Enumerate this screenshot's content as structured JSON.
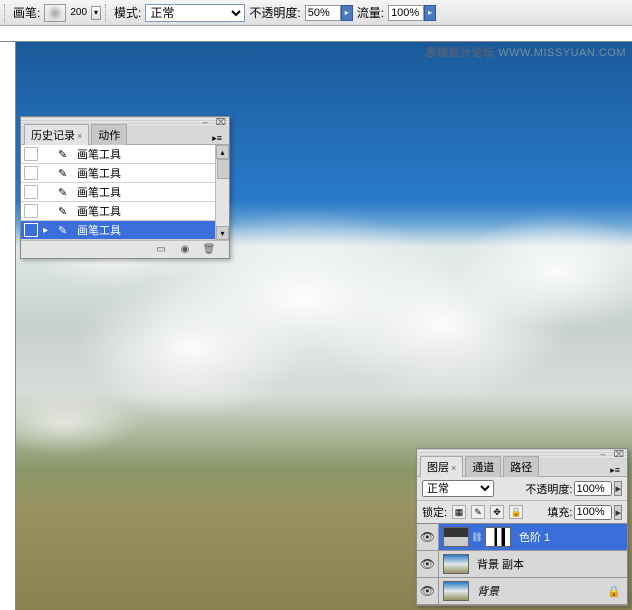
{
  "toolbar": {
    "brush_label": "画笔:",
    "brush_size": "200",
    "mode_label": "模式:",
    "mode_value": "正常",
    "opacity_label": "不透明度:",
    "opacity_value": "50%",
    "flow_label": "流量:",
    "flow_value": "100%"
  },
  "watermark": {
    "brand": "思缘设计论坛",
    "url": "WWW.MISSYUAN.COM"
  },
  "history_panel": {
    "tabs": [
      {
        "label": "历史记录",
        "active": true
      },
      {
        "label": "动作",
        "active": false
      }
    ],
    "items": [
      {
        "label": "画笔工具",
        "selected": false,
        "marker": false
      },
      {
        "label": "画笔工具",
        "selected": false,
        "marker": false
      },
      {
        "label": "画笔工具",
        "selected": false,
        "marker": false
      },
      {
        "label": "画笔工具",
        "selected": false,
        "marker": false
      },
      {
        "label": "画笔工具",
        "selected": true,
        "marker": true
      }
    ]
  },
  "layers_panel": {
    "tabs": [
      {
        "label": "图层",
        "active": true
      },
      {
        "label": "通道",
        "active": false
      },
      {
        "label": "路径",
        "active": false
      }
    ],
    "blend_mode": "正常",
    "opacity_label": "不透明度:",
    "opacity_value": "100%",
    "lock_label": "锁定:",
    "fill_label": "填充:",
    "fill_value": "100%",
    "layers": [
      {
        "name": "色阶 1",
        "type": "adjustment",
        "selected": true
      },
      {
        "name": "背景 副本",
        "type": "image",
        "selected": false
      },
      {
        "name": "背景",
        "type": "image",
        "selected": false
      }
    ]
  }
}
